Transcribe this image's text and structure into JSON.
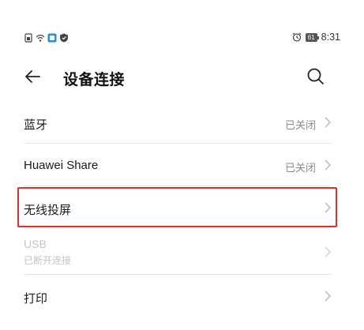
{
  "status_bar": {
    "time": "8:31",
    "battery": "61",
    "icons": [
      "sim-icon",
      "wifi-icon",
      "app-notification-icon",
      "shield-icon",
      "alarm-icon",
      "battery-icon"
    ]
  },
  "app_bar": {
    "title": "设备连接",
    "back_icon": "arrow-left-icon",
    "search_icon": "search-icon"
  },
  "items": [
    {
      "title": "蓝牙",
      "status": "已关闭"
    },
    {
      "title": "Huawei Share",
      "status": "已关闭"
    },
    {
      "title": "无线投屏",
      "status": ""
    },
    {
      "title": "USB",
      "subtitle": "已断开连接",
      "disabled": true
    },
    {
      "title": "打印",
      "status": ""
    }
  ],
  "colors": {
    "highlight": "#d9342b",
    "secondary_text": "#8a8a8a",
    "disabled_text": "#c4c4c4"
  }
}
